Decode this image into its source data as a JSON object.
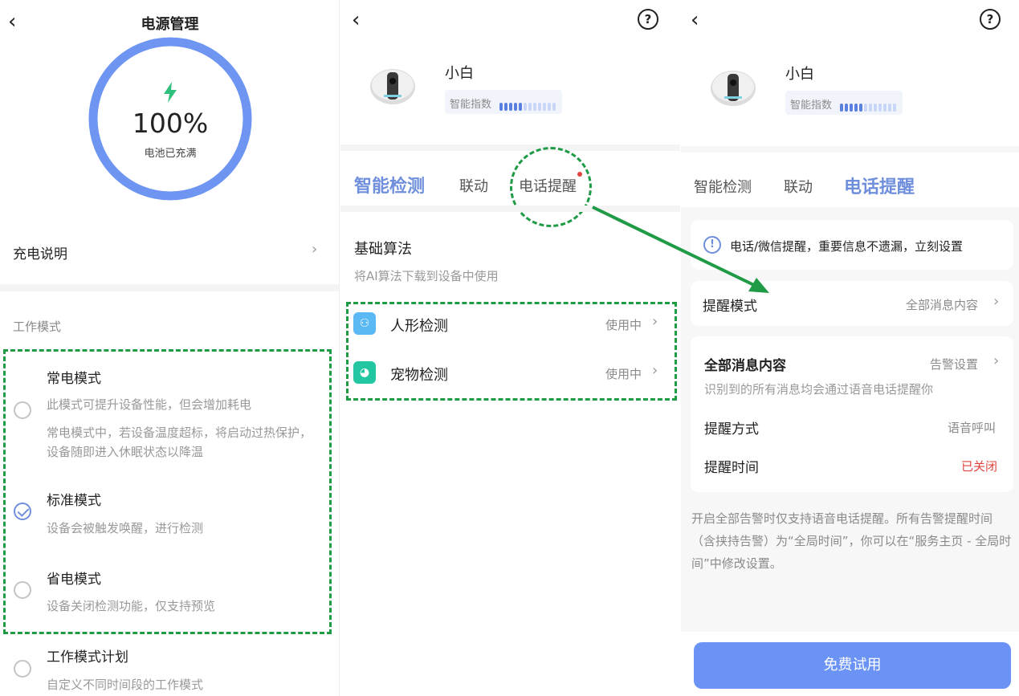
{
  "panel1": {
    "back_glyph": "‹",
    "title": "电源管理",
    "battery": {
      "percent_text": "100%",
      "status": "电池已充满",
      "level": 1.0
    },
    "charge_info": "充电说明",
    "work_mode_header": "工作模式",
    "modes": [
      {
        "title": "常电模式",
        "desc": "此模式可提升设备性能，但会增加耗电",
        "desc2": "常电模式中，若设备温度超标，将启动过热保护，设备随即进入休眠状态以降温",
        "selected": false
      },
      {
        "title": "标准模式",
        "desc": "设备会被触发唤醒，进行检测",
        "desc2": "",
        "selected": true
      },
      {
        "title": "省电模式",
        "desc": "设备关闭检测功能，仅支持预览",
        "desc2": "",
        "selected": false
      }
    ],
    "plan": {
      "title": "工作模式计划",
      "desc": "自定义不同时间段的工作模式"
    }
  },
  "panel2": {
    "back_glyph": "‹",
    "help_glyph": "?",
    "device_name": "小白",
    "smart_index_label": "智能指数",
    "smart_index_level": 5,
    "smart_index_max": 12,
    "tabs": [
      {
        "label": "智能检测",
        "active": true
      },
      {
        "label": "联动",
        "active": false
      },
      {
        "label": "电话提醒",
        "active": false
      }
    ],
    "section_title": "基础算法",
    "section_desc": "将AI算法下载到设备中使用",
    "algorithms": [
      {
        "name": "人形检测",
        "status": "使用中",
        "icon": "person-detect-icon"
      },
      {
        "name": "宠物检测",
        "status": "使用中",
        "icon": "pet-detect-icon"
      }
    ]
  },
  "panel3": {
    "back_glyph": "‹",
    "help_glyph": "?",
    "device_name": "小白",
    "smart_index_label": "智能指数",
    "tabs": [
      {
        "label": "智能检测",
        "active": false
      },
      {
        "label": "联动",
        "active": false
      },
      {
        "label": "电话提醒",
        "active": true
      }
    ],
    "notice": "电话/微信提醒，重要信息不遗漏，立刻设置",
    "remind_mode_label": "提醒模式",
    "remind_mode_value": "全部消息内容",
    "all_msg_title": "全部消息内容",
    "alarm_setting": "告警设置",
    "all_msg_desc": "识别到的所有消息均会通过语音电话提醒你",
    "remind_method_label": "提醒方式",
    "remind_method_value": "语音呼叫",
    "remind_time_label": "提醒时间",
    "remind_time_value": "已关闭",
    "footnote": "开启全部告警时仅支持语音电话提醒。所有告警提醒时间（含挟持告警）为“全局时间”，你可以在“服务主页 - 全局时间”中修改设置。",
    "cta": "免费试用"
  },
  "colors": {
    "accent_blue": "#6f8fdc",
    "ring_blue": "#6f95f2",
    "bolt_green": "#2fc07e",
    "annotation_green": "#1f9a45",
    "alert_red": "#e0443e",
    "button_blue": "#6b93f5"
  }
}
